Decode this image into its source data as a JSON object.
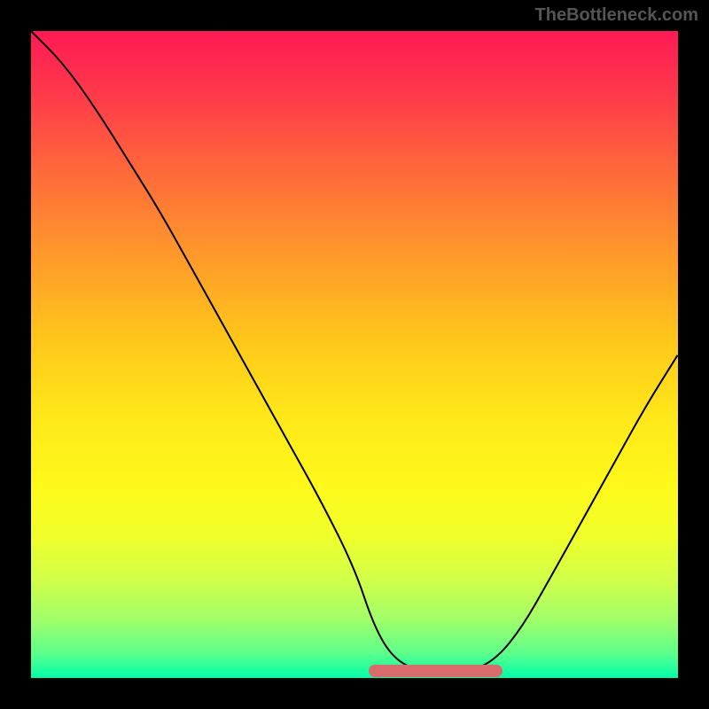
{
  "watermark": "TheBottleneck.com",
  "chart_data": {
    "type": "line",
    "title": "",
    "xlabel": "",
    "ylabel": "",
    "xlim": [
      0,
      100
    ],
    "ylim": [
      0,
      100
    ],
    "series": [
      {
        "name": "curve",
        "x": [
          0,
          5,
          10,
          15,
          20,
          25,
          30,
          35,
          40,
          45,
          50,
          53,
          56,
          60,
          64,
          68,
          72,
          76,
          80,
          85,
          90,
          95,
          100
        ],
        "y": [
          100,
          95,
          88,
          80,
          72,
          63,
          54,
          45,
          36,
          27,
          17,
          8,
          3,
          1,
          1,
          1,
          3,
          8,
          15,
          24,
          33,
          42,
          50
        ],
        "color": "#000000"
      },
      {
        "name": "optimal-zone",
        "x": [
          53,
          56,
          60,
          64,
          68,
          72
        ],
        "y": [
          8,
          3,
          1,
          1,
          1,
          3
        ],
        "color": "#d86b6b"
      }
    ],
    "annotations": []
  },
  "colors": {
    "gradient_top": "#ff1a55",
    "gradient_bottom": "#00ffaa",
    "curve": "#000000",
    "highlight": "#d86b6b",
    "background": "#000000"
  }
}
